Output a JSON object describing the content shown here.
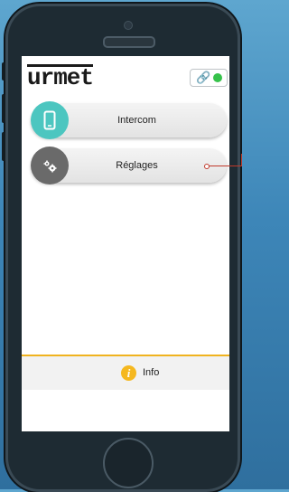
{
  "app": {
    "brand": "urmet"
  },
  "header": {
    "connection_status": "connected",
    "link_icon": "link-icon",
    "status_color": "#36c24a"
  },
  "menu": {
    "items": [
      {
        "label": "Intercom",
        "icon": "phone-icon",
        "color": "#4cc6c0"
      },
      {
        "label": "Réglages",
        "icon": "gear-icon",
        "color": "#6a6a6a"
      }
    ]
  },
  "footer": {
    "info_label": "Info",
    "info_icon_glyph": "i",
    "accent": "#f0b31f"
  }
}
